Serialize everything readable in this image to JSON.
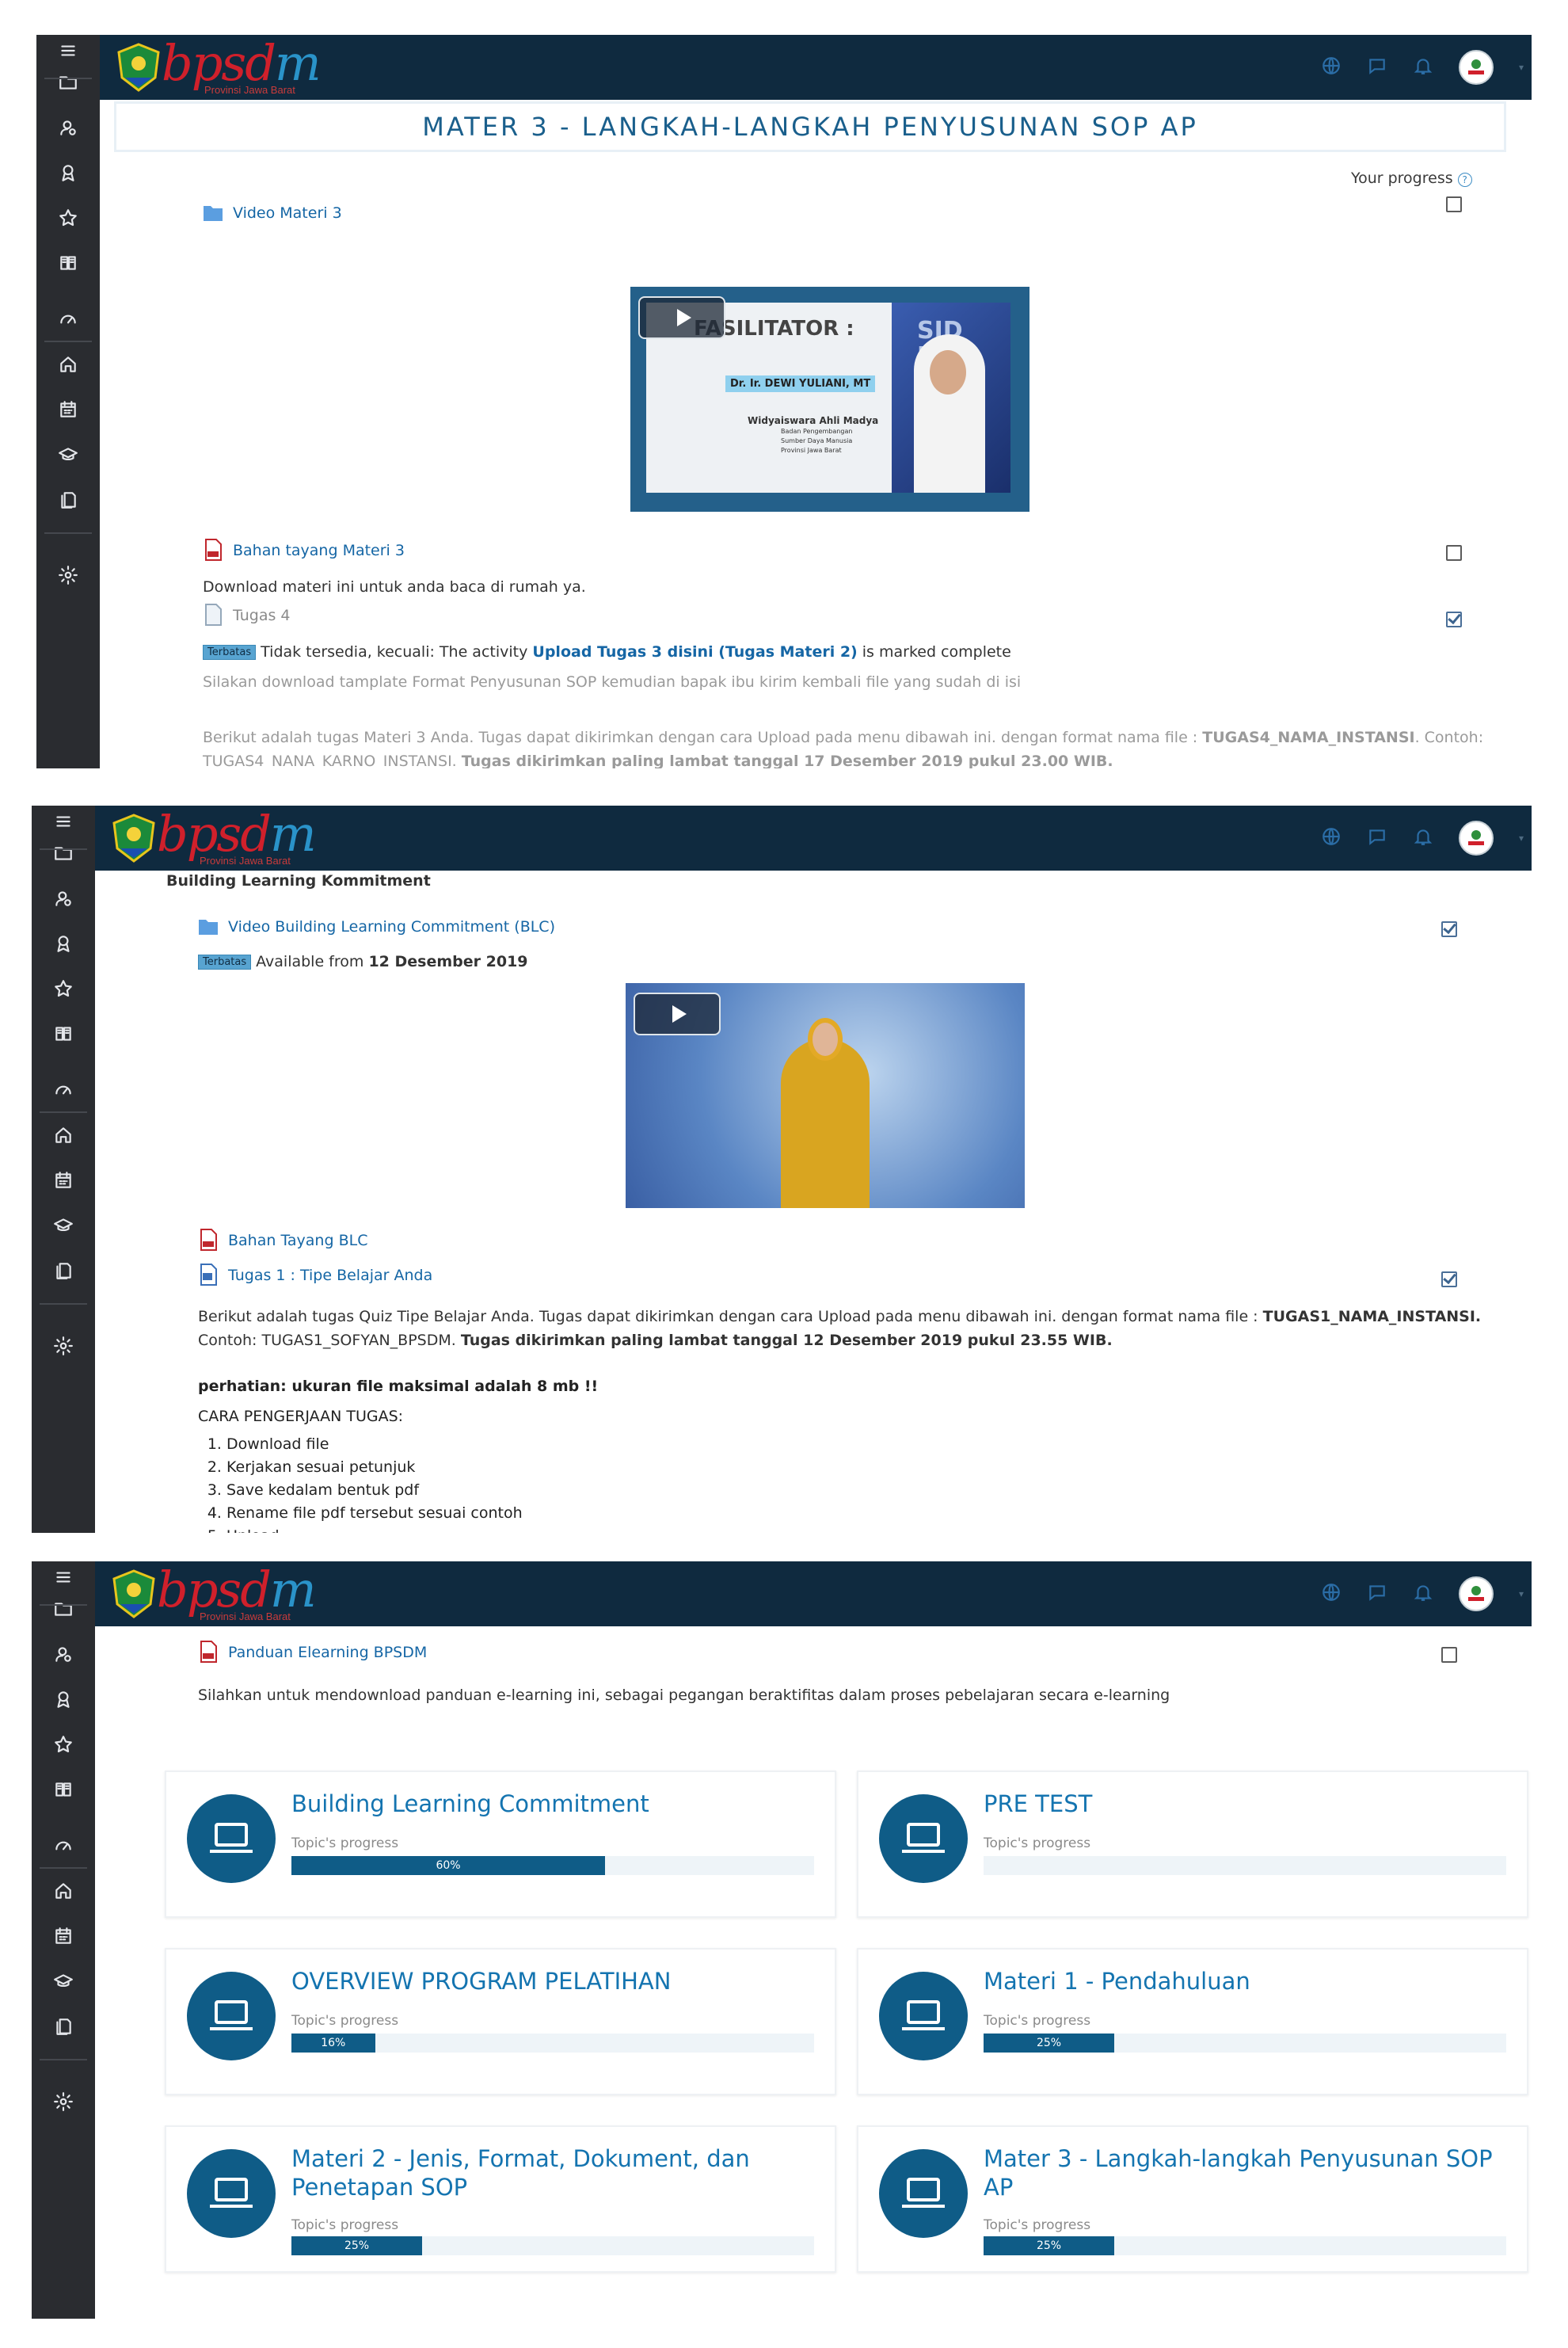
{
  "logo": {
    "brand_text_a": "bpsd",
    "brand_text_b": "m",
    "subtitle": "Provinsi Jawa Barat"
  },
  "icons": {
    "sidebar": [
      "menu-icon",
      "folder-icon",
      "user-badge-icon",
      "award-icon",
      "star-icon",
      "book-icon",
      "gauge-icon",
      "home-icon",
      "calendar-icon",
      "graduation-cap-icon",
      "files-icon",
      "gear-icon"
    ],
    "topbar": [
      "globe-icon",
      "chat-icon",
      "bell-icon"
    ]
  },
  "colors": {
    "topbar": "#0f2a3f",
    "sidebar": "#2a2c30",
    "accent": "#0f5c87",
    "link": "#1566a5",
    "logo_red": "#d0202b"
  },
  "screen1": {
    "section_title": "MATER 3 - LANGKAH-LANGKAH PENYUSUNAN SOP AP",
    "your_progress": "Your progress",
    "help_glyph": "?",
    "video_link": "Video Materi 3",
    "video_thumb": {
      "heading": "FASILITATOR :",
      "name": "Dr. Ir. DEWI YULIANI, MT",
      "role": "Widyaiswara Ahli Madya",
      "org1": "Badan Pengembangan",
      "org2": "Sumber Daya Manusia",
      "org3": "Provinsi Jawa Barat",
      "bg_letters": "SID PG"
    },
    "bahan_link": "Bahan tayang Materi 3",
    "bahan_desc": "Download materi ini untuk anda baca di rumah ya.",
    "tugas_label": "Tugas 4",
    "restricted_badge": "Terbatas",
    "restricted_prefix": "Tidak tersedia, kecuali: The activity",
    "restricted_link": "Upload Tugas 3 disini (Tugas Materi 2)",
    "restricted_suffix": "is marked complete",
    "instruction": "Silakan download tamplate Format Penyusunan SOP kemudian bapak ibu kirim kembali file yang sudah di isi",
    "task_text_1": "Berikut adalah tugas Materi 3 Anda. Tugas dapat dikirimkan dengan cara Upload pada menu dibawah ini. dengan format nama file :",
    "task_format": "TUGAS4_NAMA_INSTANSI",
    "task_text_2": ". Contoh:",
    "task_example": "TUGAS4_NANA_KARNO_INSTANSI.",
    "task_deadline": "Tugas dikirimkan paling lambat tanggal 17 Desember 2019 pukul 23.00 WIB."
  },
  "screen2": {
    "section_heading": "Building Learning Kommitment",
    "video_link": "Video Building Learning Commitment (BLC)",
    "restricted_badge": "Terbatas",
    "available_prefix": "Available from",
    "available_date": "12 Desember 2019",
    "bahan_link": "Bahan Tayang BLC",
    "tugas_link": "Tugas 1 : Tipe Belajar Anda",
    "task_text_1": "Berikut adalah tugas Quiz Tipe Belajar Anda. Tugas dapat dikirimkan dengan cara Upload pada menu dibawah ini. dengan format nama file :",
    "task_format": "TUGAS1_NAMA_INSTANSI.",
    "task_example_prefix": "Contoh: TUGAS1_SOFYAN_BPSDM.",
    "task_deadline": "Tugas dikirimkan paling lambat tanggal 12 Desember 2019 pukul 23.55 WIB.",
    "note": "perhatian: ukuran file maksimal adalah 8 mb !!",
    "steps_title": "CARA PENGERJAAN TUGAS:",
    "steps": [
      "Download file",
      "Kerjakan sesuai petunjuk",
      "Save kedalam bentuk pdf",
      "Rename file pdf tersebut sesuai contoh",
      "Upload"
    ]
  },
  "screen3": {
    "panduan_link": "Panduan Elearning BPSDM",
    "panduan_desc": "Silahkan untuk mendownload panduan e-learning ini, sebagai pegangan beraktifitas dalam proses pebelajaran secara e-learning",
    "progress_label": "Topic's progress",
    "cards": [
      {
        "title": "Building Learning Commitment",
        "progress": 60,
        "progress_text": "60%"
      },
      {
        "title": "PRE TEST",
        "progress": 0,
        "progress_text": ""
      },
      {
        "title": "OVERVIEW PROGRAM PELATIHAN",
        "progress": 16,
        "progress_text": "16%"
      },
      {
        "title": "Materi 1 - Pendahuluan",
        "progress": 25,
        "progress_text": "25%"
      },
      {
        "title": "Materi 2 - Jenis, Format, Dokument, dan Penetapan SOP",
        "progress": 25,
        "progress_text": "25%"
      },
      {
        "title": "Mater 3 - Langkah-langkah Penyusunan SOP AP",
        "progress": 25,
        "progress_text": "25%"
      }
    ]
  }
}
